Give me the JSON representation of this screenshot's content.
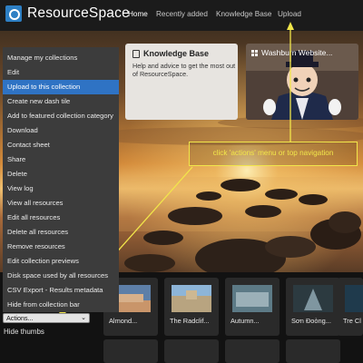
{
  "header": {
    "logo_text": "ResourceSpace",
    "nav": [
      "Home",
      "Recently added",
      "Knowledge Base",
      "Upload"
    ],
    "active_nav": "Home"
  },
  "tiles": {
    "knowledge_base": {
      "title": "Knowledge Base",
      "description": "Help and advice to get the most out of ResourceSpace.",
      "icon": "book-icon"
    },
    "washburn": {
      "title": "Washburn Website...",
      "icon": "grid-icon"
    }
  },
  "menu": {
    "items": [
      "Manage my collections",
      "Edit",
      "Upload to this collection",
      "Create new dash tile",
      "Add to featured collection category",
      "Download",
      "Contact sheet",
      "Share",
      "Delete",
      "View log",
      "View all resources",
      "Edit all resources",
      "Delete all resources",
      "Remove resources",
      "Edit collection previews",
      "Disk space used by all resources",
      "CSV Export - Results metadata",
      "Hide from collection bar"
    ],
    "selected": "Upload to this collection"
  },
  "collection_bar": {
    "actions_label": "Actions...",
    "hide_thumbs": "Hide thumbs"
  },
  "annotation": {
    "text": "click 'actions' menu or top navigation",
    "color": "#f2e64a"
  },
  "thumbnails": [
    "Almond...",
    "The Radclif...",
    "Autumn...",
    "Sơn Đoòng...",
    "Tre Cl"
  ],
  "colors": {
    "accent": "#2f73c4",
    "menu_bg": "#3c3c3c",
    "header_bg": "#1b1b1b"
  }
}
